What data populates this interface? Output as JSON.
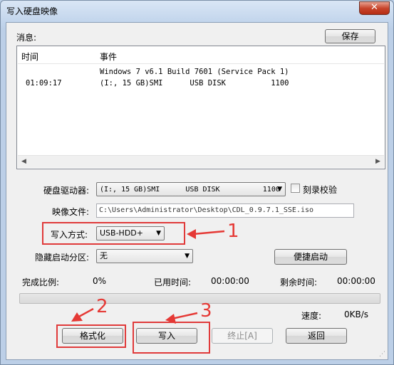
{
  "window": {
    "title": "写入硬盘映像",
    "close_label": "✕"
  },
  "log": {
    "label": "消息:",
    "save_button": "保存",
    "col_time": "时间",
    "col_event": "事件",
    "rows": [
      {
        "time": "",
        "event": "Windows 7 v6.1 Build 7601 (Service Pack 1)"
      },
      {
        "time": "01:09:17",
        "event": "(I:, 15 GB)SMI      USB DISK          1100"
      }
    ]
  },
  "drive": {
    "label": "硬盘驱动器:",
    "value": "(I:, 15 GB)SMI      USB DISK          1100",
    "verify_label": "刻录校验"
  },
  "image": {
    "label": "映像文件:",
    "path": "C:\\Users\\Administrator\\Desktop\\CDL_0.9.7.1_SSE.iso"
  },
  "write_mode": {
    "label": "写入方式:",
    "value": "USB-HDD+"
  },
  "hidden_partition": {
    "label": "隐藏启动分区:",
    "value": "无"
  },
  "quick_boot_button": "便捷启动",
  "status": {
    "completion_label": "完成比例:",
    "completion_value": "0%",
    "elapsed_label": "已用时间:",
    "elapsed_value": "00:00:00",
    "remaining_label": "剩余时间:",
    "remaining_value": "00:00:00",
    "speed_label": "速度:",
    "speed_value": "0KB/s",
    "progress": 0
  },
  "buttons": {
    "format": "格式化",
    "write": "写入",
    "stop": "终止[A]",
    "back": "返回"
  },
  "annotations": {
    "n1": "1",
    "n2": "2",
    "n3": "3"
  },
  "colors": {
    "annotation": "#e53935"
  }
}
